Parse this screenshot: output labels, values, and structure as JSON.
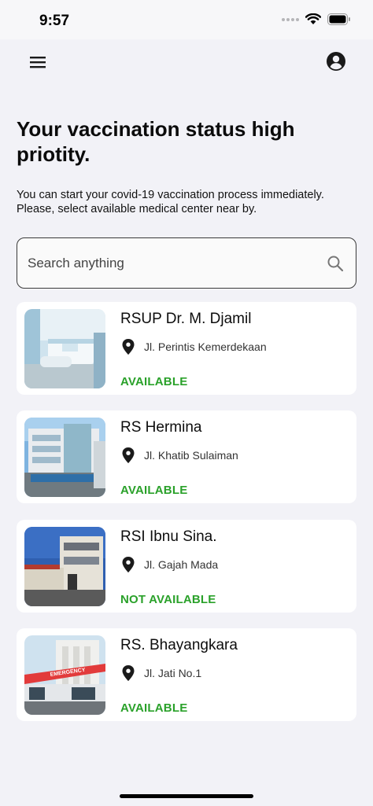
{
  "status_bar": {
    "time": "9:57"
  },
  "header": {
    "menu_icon": "hamburger-menu-icon",
    "account_icon": "account-circle-icon"
  },
  "main": {
    "title": "Your vaccination status high priotity.",
    "subtitle": "You can start your covid-19 vaccination process immediately. Please, select available medical center near by.",
    "search": {
      "placeholder": "Search anything",
      "value": "",
      "icon": "search-icon"
    }
  },
  "centers": [
    {
      "name": "RSUP Dr. M. Djamil",
      "address": "Jl. Perintis Kemerdekaan",
      "status": "AVAILABLE"
    },
    {
      "name": "RS Hermina",
      "address": "Jl. Khatib Sulaiman",
      "status": "AVAILABLE"
    },
    {
      "name": "RSI Ibnu Sina.",
      "address": "Jl. Gajah Mada",
      "status": "NOT AVAILABLE"
    },
    {
      "name": "RS. Bhayangkara",
      "address": "Jl. Jati No.1",
      "status": "AVAILABLE",
      "thumb_sign": "EMERGENCY"
    }
  ],
  "colors": {
    "available": "#2aa12a",
    "background": "#f2f2f7",
    "card": "#ffffff"
  }
}
